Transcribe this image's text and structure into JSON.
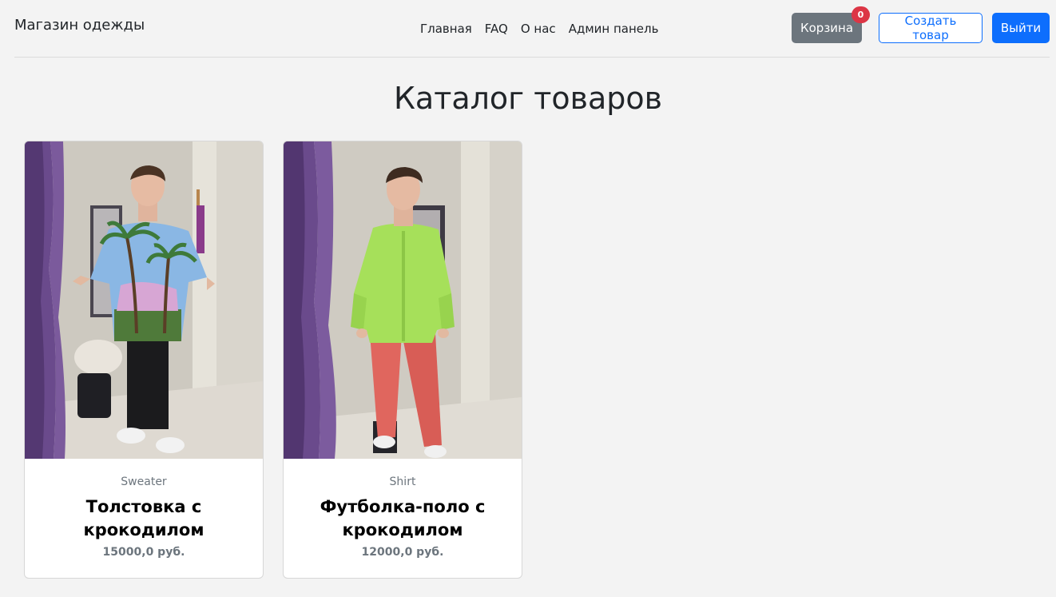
{
  "header": {
    "brand": "Магазин одежды",
    "nav": [
      "Главная",
      "FAQ",
      "О нас",
      "Админ панель"
    ],
    "cart_label": "Корзина",
    "cart_count": "0",
    "create_label": "Создать товар",
    "logout_label": "Выйти"
  },
  "main": {
    "title": "Каталог товаров",
    "products": [
      {
        "category": "Sweater",
        "name": "Толстовка с крокодилом",
        "price": "15000,0 руб."
      },
      {
        "category": "Shirt",
        "name": "Футболка-поло с крокодилом",
        "price": "12000,0 руб."
      }
    ]
  },
  "colors": {
    "primary": "#0d6efd",
    "secondary": "#6c757d",
    "danger": "#dc3545",
    "background": "#f3f3f3"
  }
}
